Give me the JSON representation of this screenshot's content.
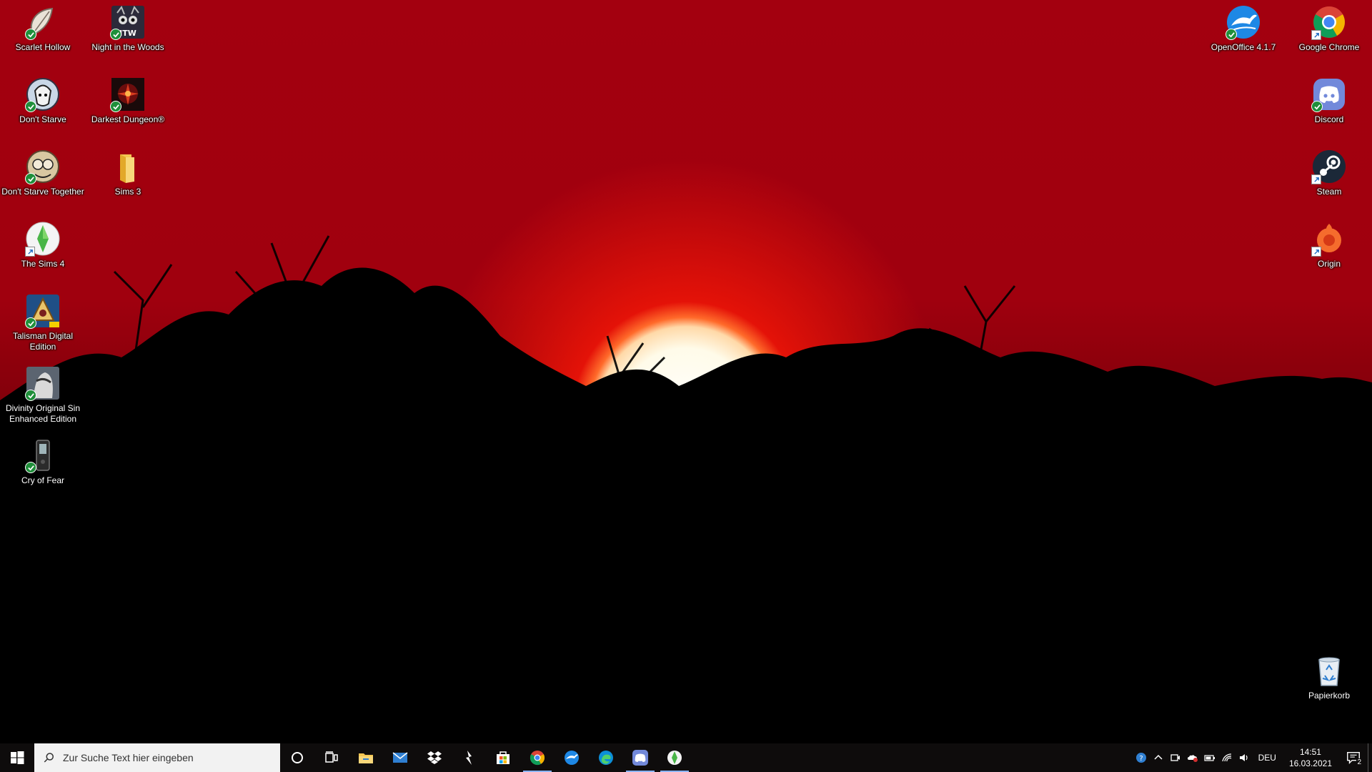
{
  "desktop": {
    "icons": [
      {
        "label": "Scarlet Hollow",
        "icon": "scarlet-hollow-icon"
      },
      {
        "label": "Night in the Woods",
        "icon": "night-in-the-woods-icon"
      },
      {
        "label": "Don't Starve",
        "icon": "dont-starve-icon"
      },
      {
        "label": "Darkest Dungeon®",
        "icon": "darkest-dungeon-icon"
      },
      {
        "label": "Don't Starve Together",
        "icon": "dont-starve-together-icon"
      },
      {
        "label": "Sims 3",
        "icon": "folder-icon"
      },
      {
        "label": "The Sims 4",
        "icon": "sims4-icon"
      },
      {
        "label": "Talisman Digital Edition",
        "icon": "talisman-icon"
      },
      {
        "label": "Divinity Original Sin Enhanced Edition",
        "icon": "divinity-icon"
      },
      {
        "label": "Cry of Fear",
        "icon": "cry-of-fear-icon"
      },
      {
        "label": "OpenOffice 4.1.7",
        "icon": "openoffice-icon"
      },
      {
        "label": "Google Chrome",
        "icon": "chrome-icon"
      },
      {
        "label": "Discord",
        "icon": "discord-icon"
      },
      {
        "label": "Steam",
        "icon": "steam-icon"
      },
      {
        "label": "Origin",
        "icon": "origin-icon"
      },
      {
        "label": "Papierkorb",
        "icon": "recycle-bin-icon"
      }
    ]
  },
  "taskbar": {
    "search_placeholder": "Zur Suche Text hier eingeben",
    "language": "DEU",
    "time": "14:51",
    "date": "16.03.2021",
    "notification_count": "2"
  },
  "colors": {
    "sky_top": "#a3000f",
    "sun": "#fffbe9",
    "taskbar": "#0e0c0c"
  }
}
